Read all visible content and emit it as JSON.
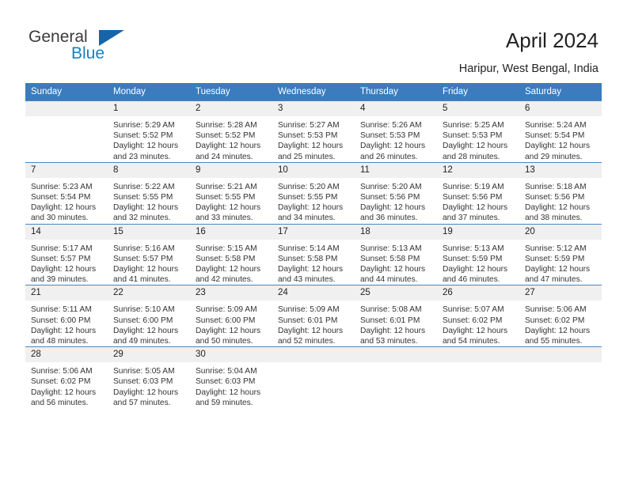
{
  "brand": {
    "name_part1": "General",
    "name_part2": "Blue",
    "accent_color": "#1a7fc1",
    "triangle_color": "#1565a8"
  },
  "header": {
    "title": "April 2024",
    "location": "Haripur, West Bengal, India"
  },
  "calendar": {
    "header_bg": "#3a7cbe",
    "daynum_bg": "#f0f0f0",
    "weekdays": [
      "Sunday",
      "Monday",
      "Tuesday",
      "Wednesday",
      "Thursday",
      "Friday",
      "Saturday"
    ],
    "labels": {
      "sunrise_prefix": "Sunrise:",
      "sunset_prefix": "Sunset:",
      "daylight_prefix": "Daylight:"
    },
    "weeks": [
      [
        {
          "day": "",
          "blank": true
        },
        {
          "day": "1",
          "sunrise": "Sunrise: 5:29 AM",
          "sunset": "Sunset: 5:52 PM",
          "daylight_l1": "Daylight: 12 hours",
          "daylight_l2": "and 23 minutes."
        },
        {
          "day": "2",
          "sunrise": "Sunrise: 5:28 AM",
          "sunset": "Sunset: 5:52 PM",
          "daylight_l1": "Daylight: 12 hours",
          "daylight_l2": "and 24 minutes."
        },
        {
          "day": "3",
          "sunrise": "Sunrise: 5:27 AM",
          "sunset": "Sunset: 5:53 PM",
          "daylight_l1": "Daylight: 12 hours",
          "daylight_l2": "and 25 minutes."
        },
        {
          "day": "4",
          "sunrise": "Sunrise: 5:26 AM",
          "sunset": "Sunset: 5:53 PM",
          "daylight_l1": "Daylight: 12 hours",
          "daylight_l2": "and 26 minutes."
        },
        {
          "day": "5",
          "sunrise": "Sunrise: 5:25 AM",
          "sunset": "Sunset: 5:53 PM",
          "daylight_l1": "Daylight: 12 hours",
          "daylight_l2": "and 28 minutes."
        },
        {
          "day": "6",
          "sunrise": "Sunrise: 5:24 AM",
          "sunset": "Sunset: 5:54 PM",
          "daylight_l1": "Daylight: 12 hours",
          "daylight_l2": "and 29 minutes."
        }
      ],
      [
        {
          "day": "7",
          "sunrise": "Sunrise: 5:23 AM",
          "sunset": "Sunset: 5:54 PM",
          "daylight_l1": "Daylight: 12 hours",
          "daylight_l2": "and 30 minutes."
        },
        {
          "day": "8",
          "sunrise": "Sunrise: 5:22 AM",
          "sunset": "Sunset: 5:55 PM",
          "daylight_l1": "Daylight: 12 hours",
          "daylight_l2": "and 32 minutes."
        },
        {
          "day": "9",
          "sunrise": "Sunrise: 5:21 AM",
          "sunset": "Sunset: 5:55 PM",
          "daylight_l1": "Daylight: 12 hours",
          "daylight_l2": "and 33 minutes."
        },
        {
          "day": "10",
          "sunrise": "Sunrise: 5:20 AM",
          "sunset": "Sunset: 5:55 PM",
          "daylight_l1": "Daylight: 12 hours",
          "daylight_l2": "and 34 minutes."
        },
        {
          "day": "11",
          "sunrise": "Sunrise: 5:20 AM",
          "sunset": "Sunset: 5:56 PM",
          "daylight_l1": "Daylight: 12 hours",
          "daylight_l2": "and 36 minutes."
        },
        {
          "day": "12",
          "sunrise": "Sunrise: 5:19 AM",
          "sunset": "Sunset: 5:56 PM",
          "daylight_l1": "Daylight: 12 hours",
          "daylight_l2": "and 37 minutes."
        },
        {
          "day": "13",
          "sunrise": "Sunrise: 5:18 AM",
          "sunset": "Sunset: 5:56 PM",
          "daylight_l1": "Daylight: 12 hours",
          "daylight_l2": "and 38 minutes."
        }
      ],
      [
        {
          "day": "14",
          "sunrise": "Sunrise: 5:17 AM",
          "sunset": "Sunset: 5:57 PM",
          "daylight_l1": "Daylight: 12 hours",
          "daylight_l2": "and 39 minutes."
        },
        {
          "day": "15",
          "sunrise": "Sunrise: 5:16 AM",
          "sunset": "Sunset: 5:57 PM",
          "daylight_l1": "Daylight: 12 hours",
          "daylight_l2": "and 41 minutes."
        },
        {
          "day": "16",
          "sunrise": "Sunrise: 5:15 AM",
          "sunset": "Sunset: 5:58 PM",
          "daylight_l1": "Daylight: 12 hours",
          "daylight_l2": "and 42 minutes."
        },
        {
          "day": "17",
          "sunrise": "Sunrise: 5:14 AM",
          "sunset": "Sunset: 5:58 PM",
          "daylight_l1": "Daylight: 12 hours",
          "daylight_l2": "and 43 minutes."
        },
        {
          "day": "18",
          "sunrise": "Sunrise: 5:13 AM",
          "sunset": "Sunset: 5:58 PM",
          "daylight_l1": "Daylight: 12 hours",
          "daylight_l2": "and 44 minutes."
        },
        {
          "day": "19",
          "sunrise": "Sunrise: 5:13 AM",
          "sunset": "Sunset: 5:59 PM",
          "daylight_l1": "Daylight: 12 hours",
          "daylight_l2": "and 46 minutes."
        },
        {
          "day": "20",
          "sunrise": "Sunrise: 5:12 AM",
          "sunset": "Sunset: 5:59 PM",
          "daylight_l1": "Daylight: 12 hours",
          "daylight_l2": "and 47 minutes."
        }
      ],
      [
        {
          "day": "21",
          "sunrise": "Sunrise: 5:11 AM",
          "sunset": "Sunset: 6:00 PM",
          "daylight_l1": "Daylight: 12 hours",
          "daylight_l2": "and 48 minutes."
        },
        {
          "day": "22",
          "sunrise": "Sunrise: 5:10 AM",
          "sunset": "Sunset: 6:00 PM",
          "daylight_l1": "Daylight: 12 hours",
          "daylight_l2": "and 49 minutes."
        },
        {
          "day": "23",
          "sunrise": "Sunrise: 5:09 AM",
          "sunset": "Sunset: 6:00 PM",
          "daylight_l1": "Daylight: 12 hours",
          "daylight_l2": "and 50 minutes."
        },
        {
          "day": "24",
          "sunrise": "Sunrise: 5:09 AM",
          "sunset": "Sunset: 6:01 PM",
          "daylight_l1": "Daylight: 12 hours",
          "daylight_l2": "and 52 minutes."
        },
        {
          "day": "25",
          "sunrise": "Sunrise: 5:08 AM",
          "sunset": "Sunset: 6:01 PM",
          "daylight_l1": "Daylight: 12 hours",
          "daylight_l2": "and 53 minutes."
        },
        {
          "day": "26",
          "sunrise": "Sunrise: 5:07 AM",
          "sunset": "Sunset: 6:02 PM",
          "daylight_l1": "Daylight: 12 hours",
          "daylight_l2": "and 54 minutes."
        },
        {
          "day": "27",
          "sunrise": "Sunrise: 5:06 AM",
          "sunset": "Sunset: 6:02 PM",
          "daylight_l1": "Daylight: 12 hours",
          "daylight_l2": "and 55 minutes."
        }
      ],
      [
        {
          "day": "28",
          "sunrise": "Sunrise: 5:06 AM",
          "sunset": "Sunset: 6:02 PM",
          "daylight_l1": "Daylight: 12 hours",
          "daylight_l2": "and 56 minutes."
        },
        {
          "day": "29",
          "sunrise": "Sunrise: 5:05 AM",
          "sunset": "Sunset: 6:03 PM",
          "daylight_l1": "Daylight: 12 hours",
          "daylight_l2": "and 57 minutes."
        },
        {
          "day": "30",
          "sunrise": "Sunrise: 5:04 AM",
          "sunset": "Sunset: 6:03 PM",
          "daylight_l1": "Daylight: 12 hours",
          "daylight_l2": "and 59 minutes."
        },
        {
          "day": "",
          "blank": true
        },
        {
          "day": "",
          "blank": true
        },
        {
          "day": "",
          "blank": true
        },
        {
          "day": "",
          "blank": true
        }
      ]
    ]
  }
}
